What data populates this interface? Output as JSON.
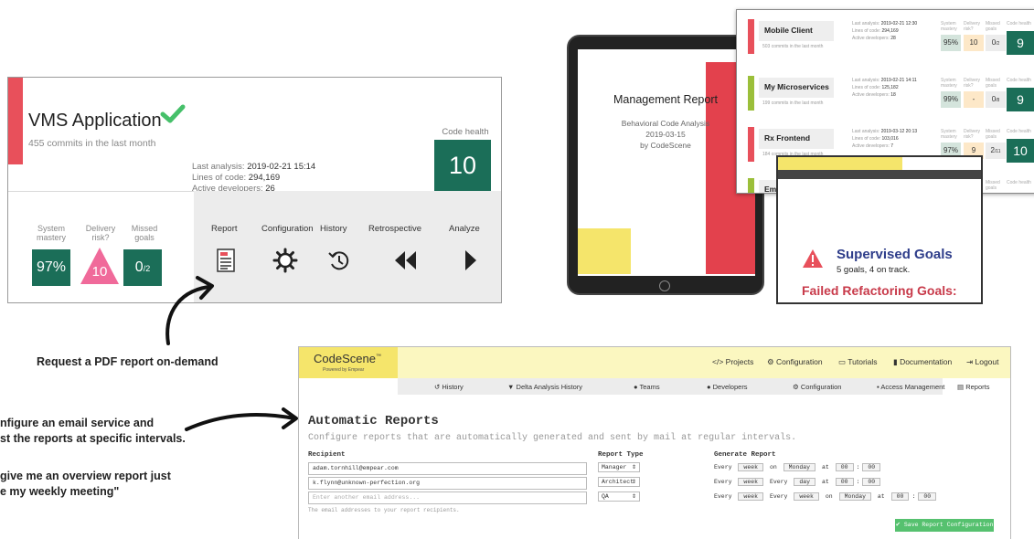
{
  "card": {
    "title": "VMS Application",
    "subtitle": "455 commits in the last month",
    "last_analysis_label": "Last analysis:",
    "last_analysis_value": "2019-02-21 15:14",
    "loc_label": "Lines of code:",
    "loc_value": "294,169",
    "devs_label": "Active developers:",
    "devs_value": "26",
    "code_health_label": "Code health",
    "code_health_value": "10",
    "metrics": [
      {
        "label": "System mastery",
        "value": "97%"
      },
      {
        "label": "Delivery risk?",
        "value": "10"
      },
      {
        "label": "Missed goals",
        "value": "0",
        "sub": "/2"
      }
    ],
    "actions": [
      "Report",
      "Configuration",
      "History",
      "Retrospective",
      "Analyze"
    ]
  },
  "captions": {
    "pdf": "Request a PDF report on-demand",
    "email_line1": "nfigure an email service and",
    "email_line2": "st the reports at specific intervals.",
    "quote_line1": "give me an overview report just",
    "quote_line2": "e my weekly meeting\""
  },
  "tablet": {
    "title": "Management Report",
    "line1": "Behavioral Code Analysis",
    "line2": "2019-03-15",
    "line3": "by CodeScene"
  },
  "projects": [
    {
      "name": "Mobile Client",
      "commits": "503 commits in the last month",
      "analysis": "2019-02-21 12:30",
      "loc": "294,169",
      "devs": "28",
      "mastery": "95%",
      "risk": "10",
      "goals": "0",
      "goals_sub": "/2",
      "health": "9",
      "color": "#e8505b"
    },
    {
      "name": "My Microservices",
      "commits": "199 commits in the last month",
      "analysis": "2019-02-21 14:11",
      "loc": "125,182",
      "devs": "18",
      "mastery": "99%",
      "risk": "-",
      "goals": "0",
      "goals_sub": "/8",
      "health": "9",
      "color": "#9bbf3a"
    },
    {
      "name": "Rx Frontend",
      "commits": "184 commits in the last month",
      "analysis": "2019-03-12 20:13",
      "loc": "103,016",
      "devs": "7",
      "mastery": "97%",
      "risk": "9",
      "goals": "2",
      "goals_sub": "/11",
      "health": "10",
      "color": "#e8505b"
    },
    {
      "name": "Em",
      "commits": "",
      "analysis": "",
      "loc": "",
      "devs": "",
      "mastery": "",
      "risk": "",
      "goals": "",
      "goals_sub": "",
      "health": "",
      "color": "#9bbf3a"
    }
  ],
  "project_labels": {
    "analysis": "Last analysis:",
    "loc": "Lines of code:",
    "devs": "Active developers:",
    "mastery": "System mastery",
    "risk": "Delivery risk?",
    "goals": "Missed goals",
    "health": "Code health"
  },
  "goals_popup": {
    "title": "Supervised Goals",
    "subtitle": "5 goals, 4 on track.",
    "failed": "Failed Refactoring Goals:"
  },
  "app": {
    "logo": "CodeScene",
    "logo_tm": "™",
    "powered": "Powered by Empear",
    "top_nav": [
      "Projects",
      "Configuration",
      "Tutorials",
      "Documentation",
      "Logout"
    ],
    "sub_nav": [
      "History",
      "Delta Analysis History",
      "Teams",
      "Developers",
      "Configuration",
      "Access Management",
      "Reports"
    ],
    "heading": "Automatic Reports",
    "subheading": "Configure reports that are automatically generated and sent by mail at regular intervals.",
    "col_recipient": "Recipient",
    "col_type": "Report Type",
    "col_generate": "Generate Report",
    "recipients": [
      "adam.tornhill@empear.com",
      "k.flynn@unknown-perfection.org"
    ],
    "recipient_placeholder": "Enter another email address...",
    "help": "The email addresses to your report recipients.",
    "types": [
      "Manager",
      "Architect",
      "QA"
    ],
    "schedules": [
      {
        "every": "Every",
        "p1": "week",
        "on": "on",
        "p2": "Monday",
        "at": "at",
        "hh": "00",
        "mm": "00"
      },
      {
        "every": "Every",
        "p1": "week",
        "every2": "Every",
        "p2": "day",
        "at": "at",
        "hh": "00",
        "mm": "00"
      },
      {
        "every": "Every",
        "p1": "week",
        "every2": "Every",
        "p2": "week",
        "on": "on",
        "p3": "Monday",
        "at": "at",
        "hh": "00",
        "mm": "00"
      }
    ],
    "save_label": "Save Report Configuration"
  },
  "colors": {
    "health_green": "#1b6e58",
    "accent_red": "#e8505b",
    "brand_yellow": "#f5e56b",
    "risk_pink": "#f06a9a",
    "save_green": "#56c16f"
  }
}
